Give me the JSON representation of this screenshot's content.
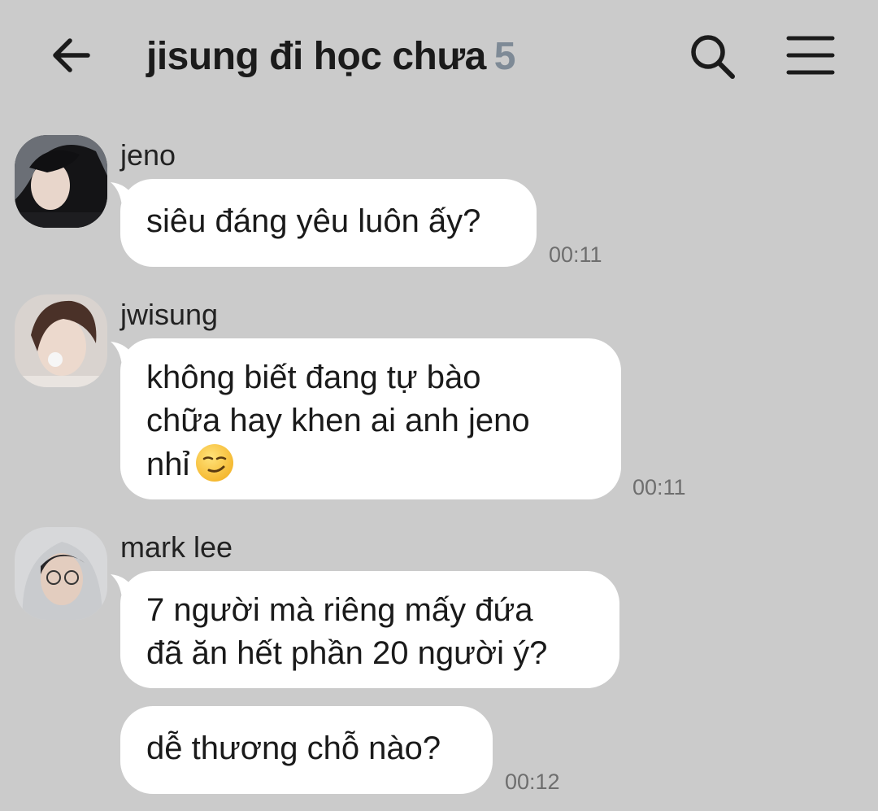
{
  "header": {
    "title": "jisung đi học chưa",
    "member_count": "5",
    "back_icon": "arrow-left-icon",
    "search_icon": "search-icon",
    "menu_icon": "hamburger-menu-icon"
  },
  "messages": [
    {
      "sender": "jeno",
      "avatar": "avatar-jeno",
      "lines": [
        "siêu đáng yêu luôn ấy?"
      ],
      "time": "00:11"
    },
    {
      "sender": "jwisung",
      "avatar": "avatar-jwisung",
      "lines": [
        "không biết đang tự bào",
        "chữa hay khen ai anh jeno",
        "nhỉ"
      ],
      "emoji": "smirk-emoji",
      "time": "00:11"
    },
    {
      "sender": "mark lee",
      "avatar": "avatar-mark-lee",
      "lines": [
        "7 người mà riêng mấy đứa",
        "đã ăn hết phần 20 người ý?"
      ]
    },
    {
      "lines": [
        "dễ thương chỗ nào?"
      ],
      "time": "00:12"
    }
  ],
  "colors": {
    "background": "#cbcbcb",
    "bubble": "#ffffff",
    "count": "#7e8a96"
  }
}
